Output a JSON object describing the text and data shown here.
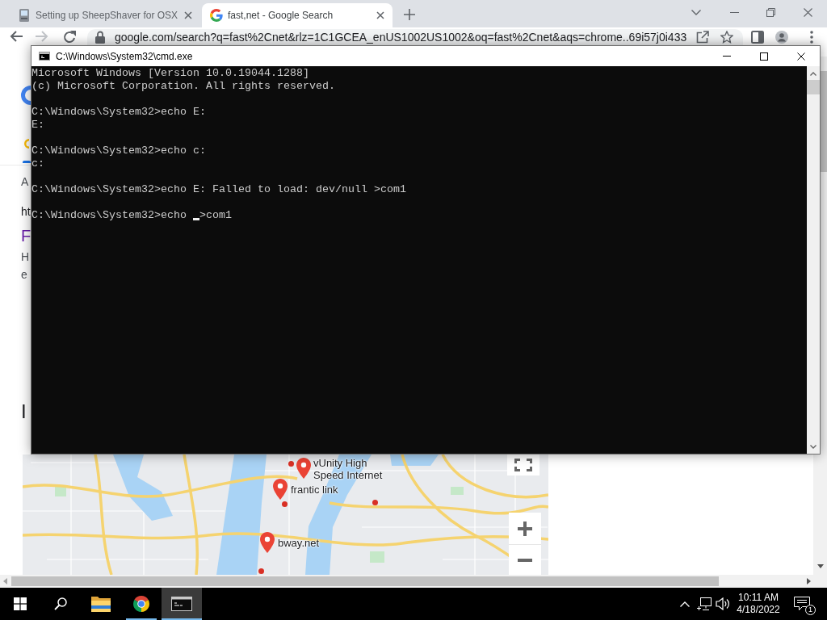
{
  "browser": {
    "tabs": [
      {
        "kind": "page",
        "title": "Setting up SheepShaver for OSX",
        "selected": false
      },
      {
        "kind": "google",
        "title": "fast,net - Google Search",
        "selected": true
      }
    ],
    "forward_enabled": false,
    "address": "google.com/search?q=fast%2Cnet&rlz=1C1GCEA_enUS1002US1002&oq=fast%2Cnet&aqs=chrome..69i57j0i433",
    "page": {
      "fragments": [
        {
          "kind": "muted",
          "text": "A"
        },
        {
          "kind": "plain",
          "text": "ht"
        },
        {
          "kind": "link",
          "text": "F"
        },
        {
          "kind": "muted",
          "text": "H"
        },
        {
          "kind": "muted",
          "text": "e"
        },
        {
          "kind": "heading",
          "text": "I"
        }
      ],
      "map": {
        "places": [
          {
            "name": "vUnity High Speed Internet"
          },
          {
            "name": "frantic link"
          },
          {
            "name": "bway.net"
          }
        ]
      }
    }
  },
  "console_window": {
    "title": "C:\\Windows\\System32\\cmd.exe",
    "blocks": [
      [
        "Microsoft Windows [Version 10.0.19044.1288]",
        "(c) Microsoft Corporation. All rights reserved."
      ],
      [
        "C:\\Windows\\System32>echo E:",
        "E:"
      ],
      [
        "C:\\Windows\\System32>echo c:",
        "c:"
      ],
      [
        "C:\\Windows\\System32>echo E: Falled to load: dev/null >com1"
      ]
    ],
    "input": {
      "before_cursor": "C:\\Windows\\System32>echo ",
      "after_cursor": ">com1"
    }
  },
  "taskbar": {
    "items": [
      {
        "kind": "start",
        "running": false,
        "active": false
      },
      {
        "kind": "search",
        "running": false,
        "active": false
      },
      {
        "kind": "folder",
        "running": false,
        "active": false
      },
      {
        "kind": "browser",
        "running": true,
        "active": false
      },
      {
        "kind": "console",
        "running": true,
        "active": true
      }
    ],
    "time": "10:11 AM",
    "date": "4/18/2022",
    "notification_count": "1"
  }
}
